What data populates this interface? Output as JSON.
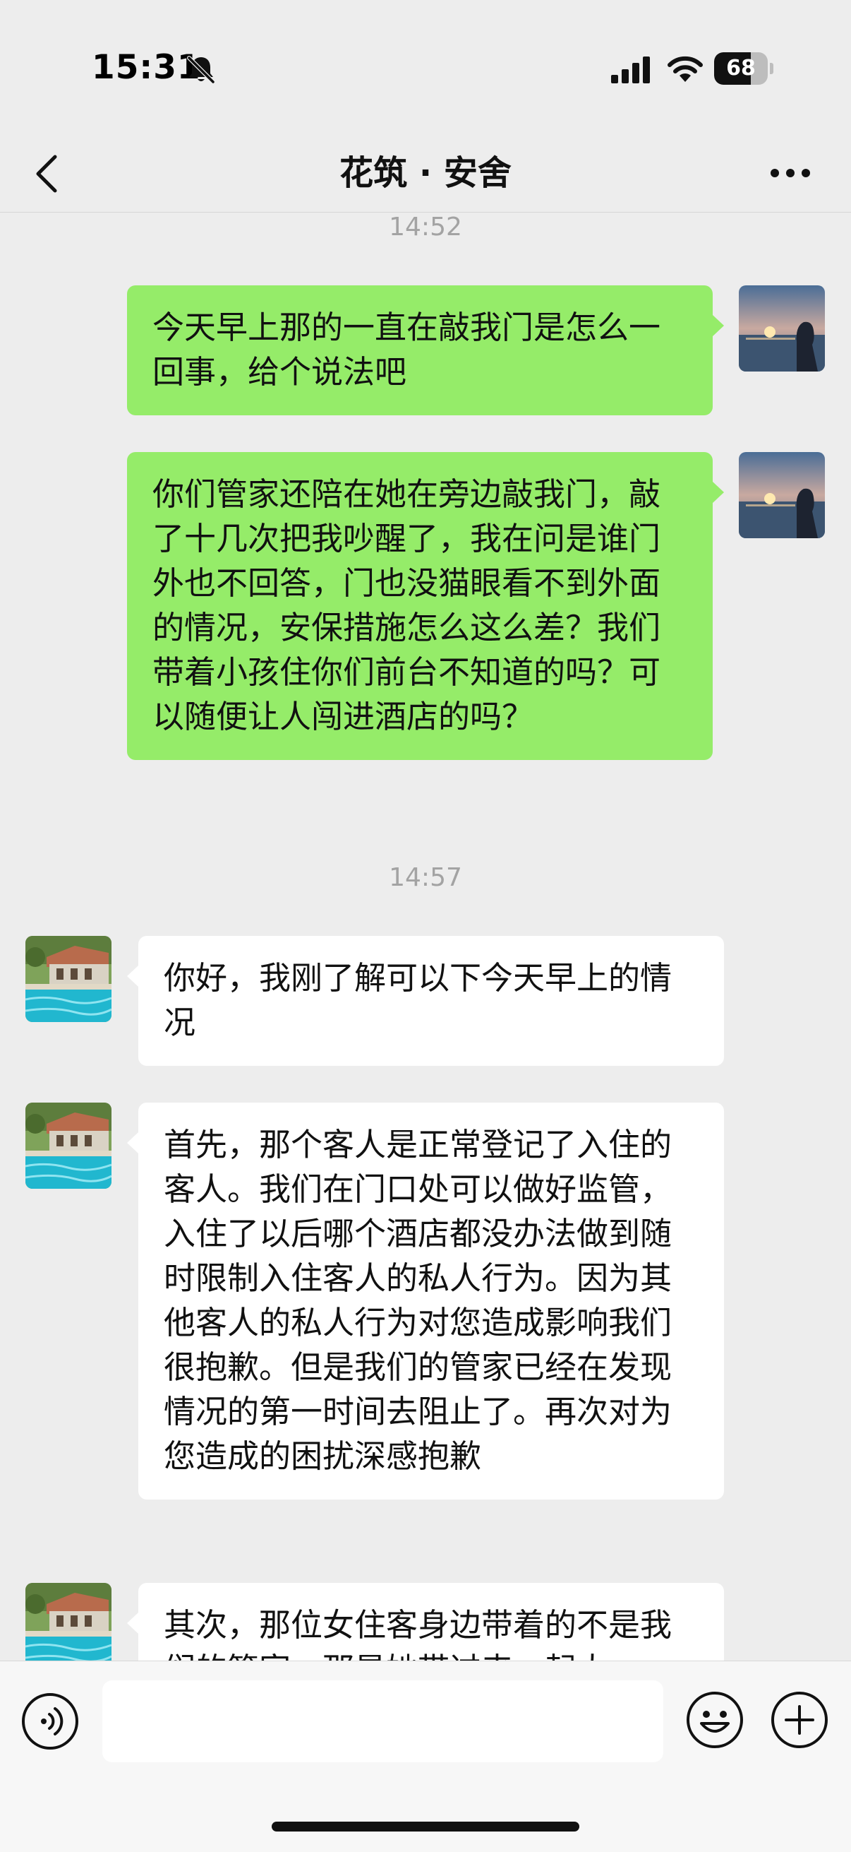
{
  "status_bar": {
    "time": "15:31",
    "battery_level": "68",
    "battery_fraction": 0.68,
    "icons": [
      "bell-slash-icon",
      "signal-icon",
      "wifi-icon",
      "battery-icon"
    ]
  },
  "nav": {
    "title": "花筑 · 安舍",
    "icons": [
      "chevron-left-icon",
      "more-dots-icon"
    ]
  },
  "colors": {
    "sent_bubble": "#95ec69",
    "received_bubble": "#ffffff",
    "background": "#ededed",
    "timestamp_text": "#a3a3a3"
  },
  "messages": [
    {
      "type": "timestamp",
      "text": "14:52"
    },
    {
      "type": "sent",
      "sender": "me",
      "text": "今天早上那的一直在敲我门是怎么一回事，给个说法吧"
    },
    {
      "type": "sent",
      "sender": "me",
      "text": "你们管家还陪在她在旁边敲我门，敲了十几次把我吵醒了，我在问是谁门外也不回答，门也没猫眼看不到外面的情况，安保措施怎么这么差？我们带着小孩住你们前台不知道的吗？可以随便让人闯进酒店的吗？"
    },
    {
      "type": "timestamp",
      "text": "14:57"
    },
    {
      "type": "received",
      "sender": "hotel",
      "text": "你好，我刚了解可以下今天早上的情况"
    },
    {
      "type": "received",
      "sender": "hotel",
      "text": "首先，那个客人是正常登记了入住的客人。我们在门口处可以做好监管，入住了以后哪个酒店都没办法做到随时限制入住客人的私人行为。因为其他客人的私人行为对您造成影响我们很抱歉。但是我们的管家已经在发现情况的第一时间去阻止了。再次对为您造成的困扰深感抱歉"
    },
    {
      "type": "received",
      "sender": "hotel",
      "text": "其次，那位女住客身边带着的不是我们的管家，那是她带过来一起大"
    }
  ],
  "input_bar": {
    "placeholder": "",
    "icons": [
      "voice-icon",
      "emoji-icon",
      "plus-icon"
    ]
  }
}
